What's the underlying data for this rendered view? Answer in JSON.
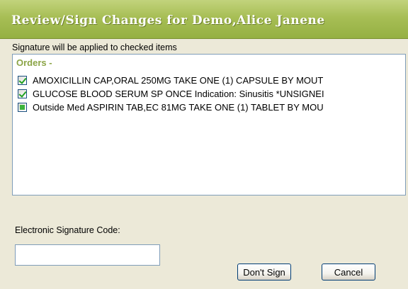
{
  "window": {
    "title": "Review/Sign Changes for Demo,Alice Janene"
  },
  "prompt": "Signature will be applied to checked items",
  "orders": {
    "header": "Orders -",
    "items": [
      {
        "text": "AMOXICILLIN CAP,ORAL  250MG TAKE ONE (1) CAPSULE BY MOUT",
        "state": "checked"
      },
      {
        "text": "GLUCOSE BLOOD   SERUM SP ONCE Indication: Sinusitis *UNSIGNEI",
        "state": "checked"
      },
      {
        "text": "Outside Med ASPIRIN TAB,EC  81MG TAKE ONE (1) TABLET BY MOU",
        "state": "indeterminate"
      }
    ]
  },
  "signature": {
    "label": "Electronic Signature Code:",
    "value": "",
    "placeholder": ""
  },
  "buttons": {
    "dont_sign": "Don't Sign",
    "cancel": "Cancel"
  }
}
